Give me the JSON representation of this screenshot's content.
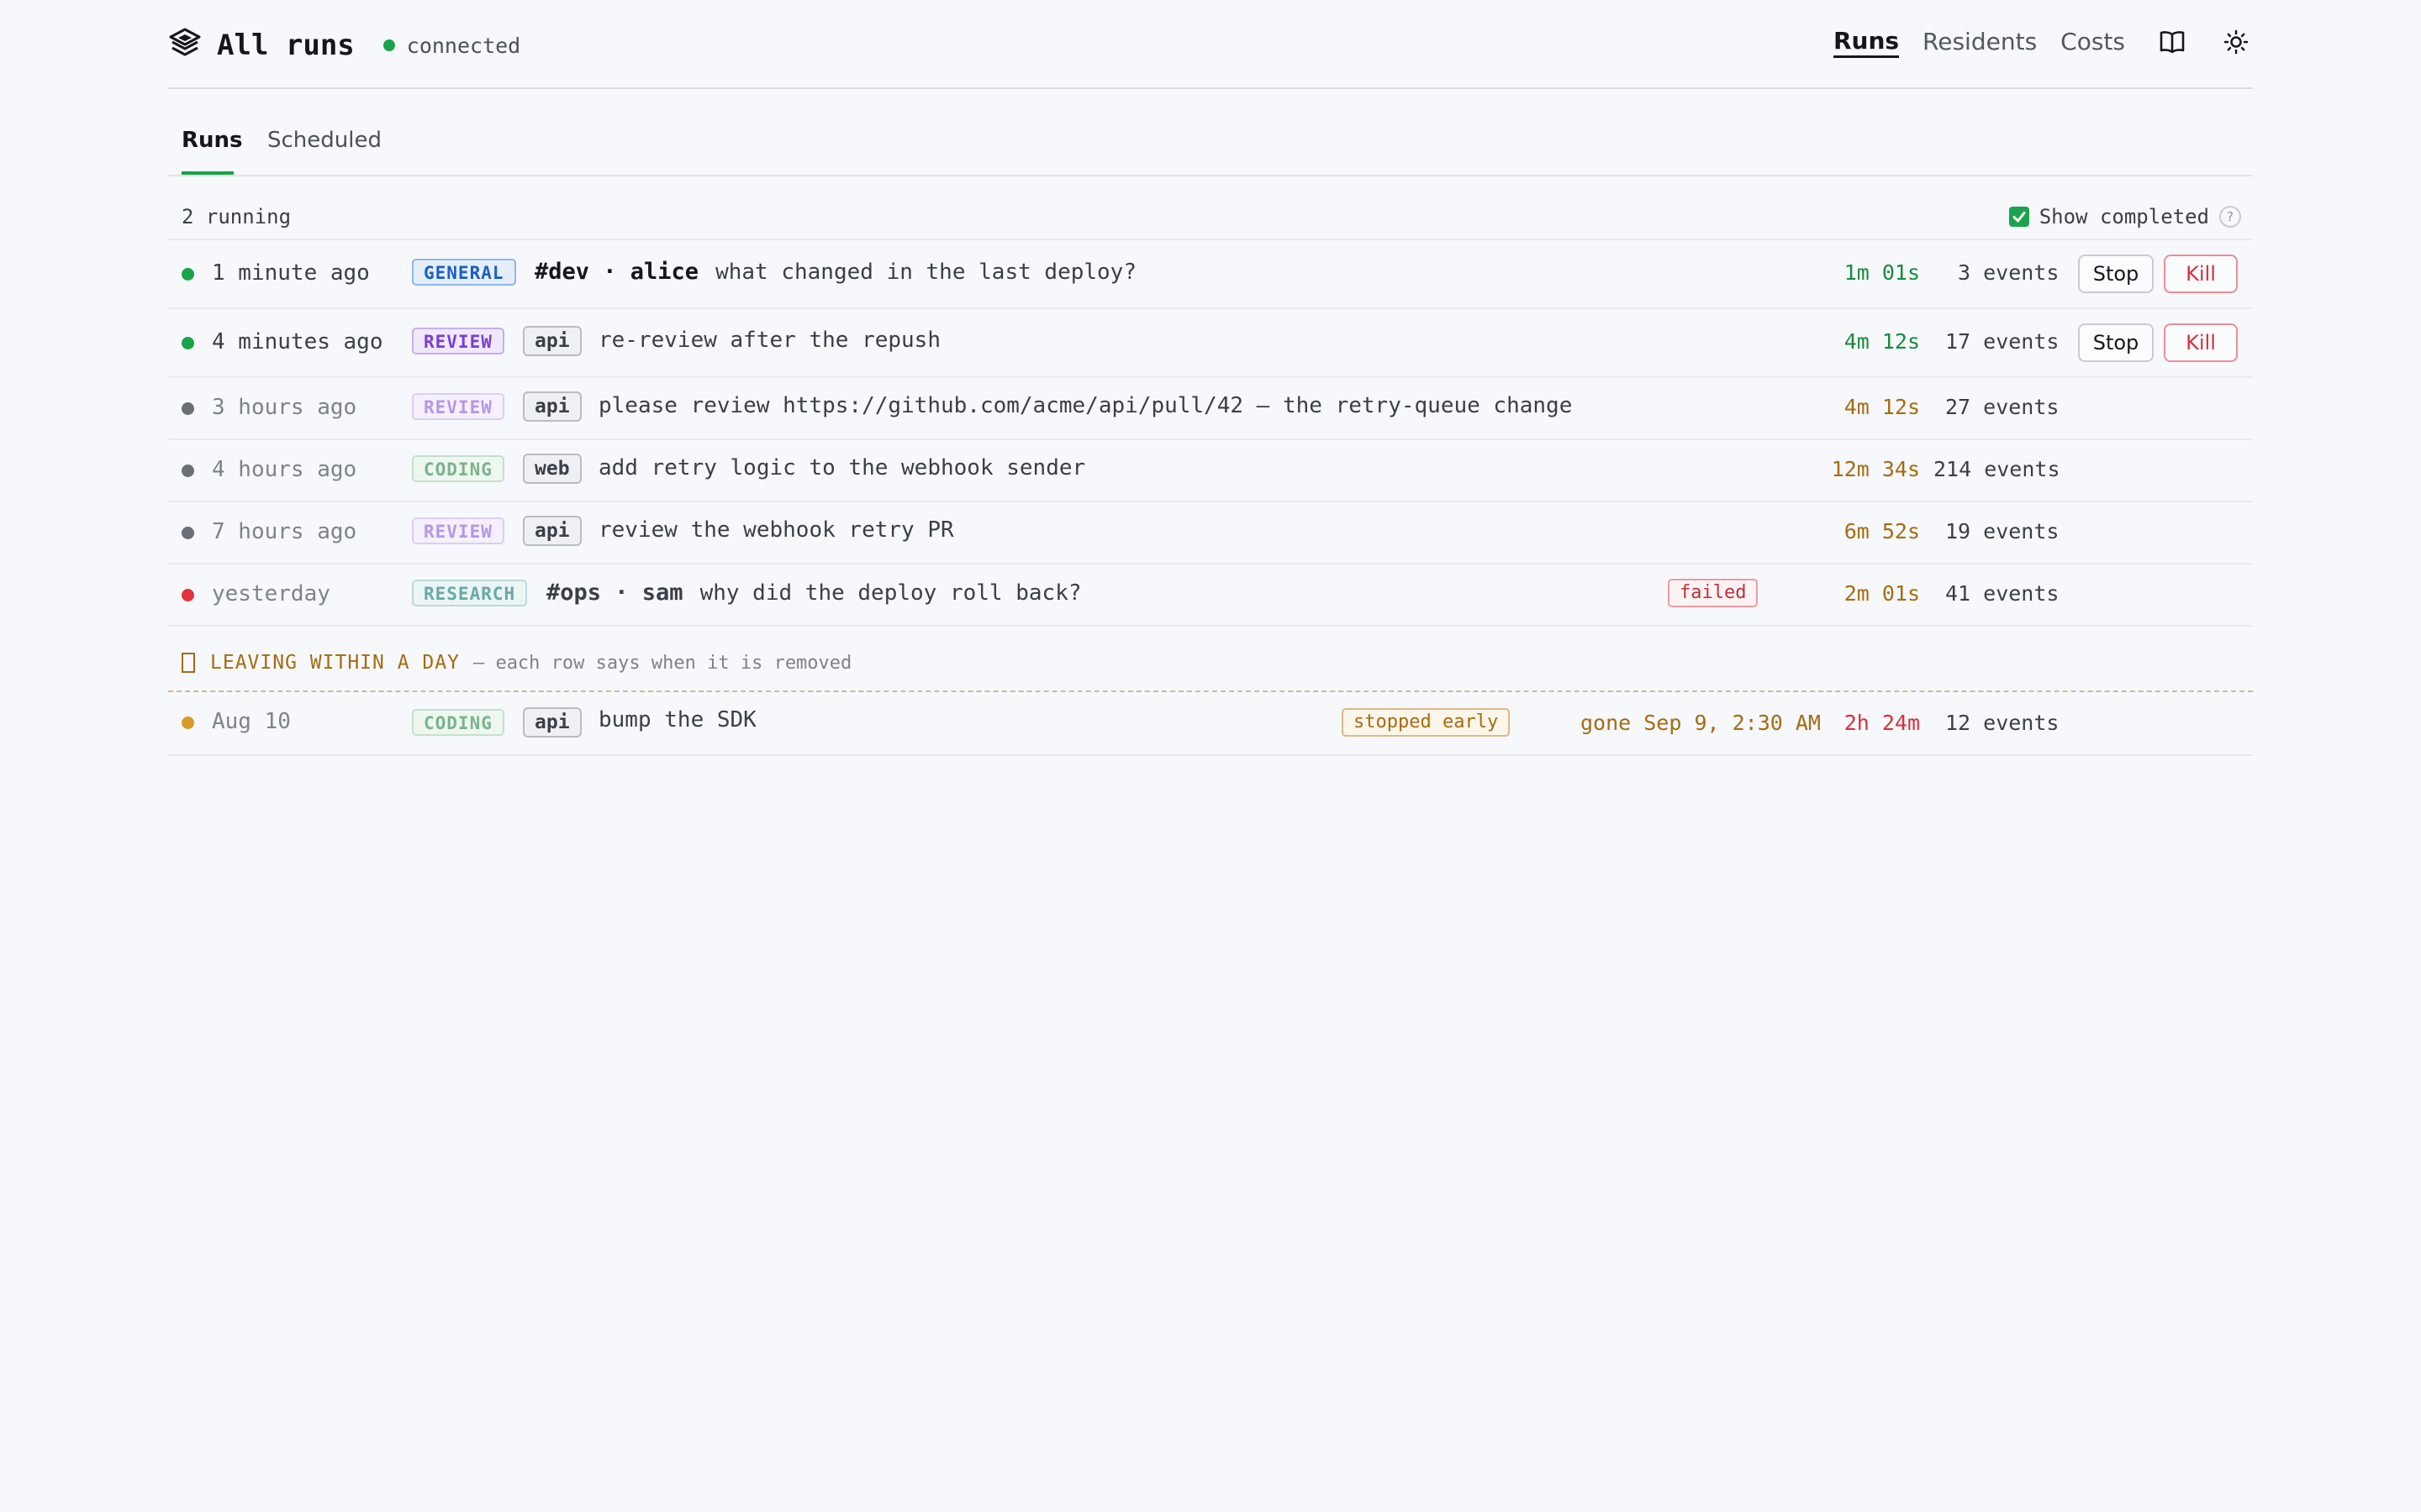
{
  "header": {
    "title": "All runs",
    "status": "connected",
    "nav": [
      "Runs",
      "Residents",
      "Costs"
    ],
    "icons": [
      "book-icon",
      "sun-icon"
    ]
  },
  "tabs": [
    "Runs",
    "Scheduled"
  ],
  "summary": {
    "running": "2 running",
    "show_completed": "Show completed",
    "show_completed_checked": true,
    "help": "?"
  },
  "buttons": {
    "stop": "Stop",
    "kill": "Kill"
  },
  "rows": [
    {
      "time": "1 minute ago",
      "badge": "GENERAL",
      "channel": "#dev · alice",
      "message": "what changed in the last deploy?",
      "duration": "1m 01s",
      "events": "3 events",
      "status": "running"
    },
    {
      "time": "4 minutes ago",
      "badge": "REVIEW",
      "tag": "api",
      "message": "re-review after the repush",
      "duration": "4m 12s",
      "events": "17 events",
      "status": "running"
    },
    {
      "time": "3 hours ago",
      "badge": "REVIEW",
      "tag": "api",
      "message": "please review https://github.com/acme/api/pull/42 — the retry-queue change",
      "duration": "4m 12s",
      "events": "27 events",
      "status": "completed"
    },
    {
      "time": "4 hours ago",
      "badge": "CODING",
      "tag": "web",
      "message": "add retry logic to the webhook sender",
      "duration": "12m 34s",
      "events": "214 events",
      "status": "completed"
    },
    {
      "time": "7 hours ago",
      "badge": "REVIEW",
      "tag": "api",
      "message": "review the webhook retry PR",
      "duration": "6m 52s",
      "events": "19 events",
      "status": "completed"
    },
    {
      "time": "yesterday",
      "badge": "RESEARCH",
      "channel": "#ops · sam",
      "message": "why did the deploy roll back?",
      "pill": "failed",
      "duration": "2m 01s",
      "events": "41 events",
      "status": "failed"
    }
  ],
  "leaving": {
    "title": "LEAVING WITHIN A DAY",
    "subtitle": "— each row says when it is removed",
    "rows": [
      {
        "time": "Aug 10",
        "badge": "CODING",
        "tag": "api",
        "message": "bump the SDK",
        "pill": "stopped early",
        "gone": "gone Sep 9, 2:30 AM",
        "duration": "2h 24m",
        "events": "12 events",
        "status": "stopped"
      }
    ]
  },
  "colors": {
    "running": "#1aa34a",
    "completed": "#6b6f76",
    "failed": "#e5323c",
    "stopped": "#d89a2b",
    "accent": "#1aa34a"
  }
}
